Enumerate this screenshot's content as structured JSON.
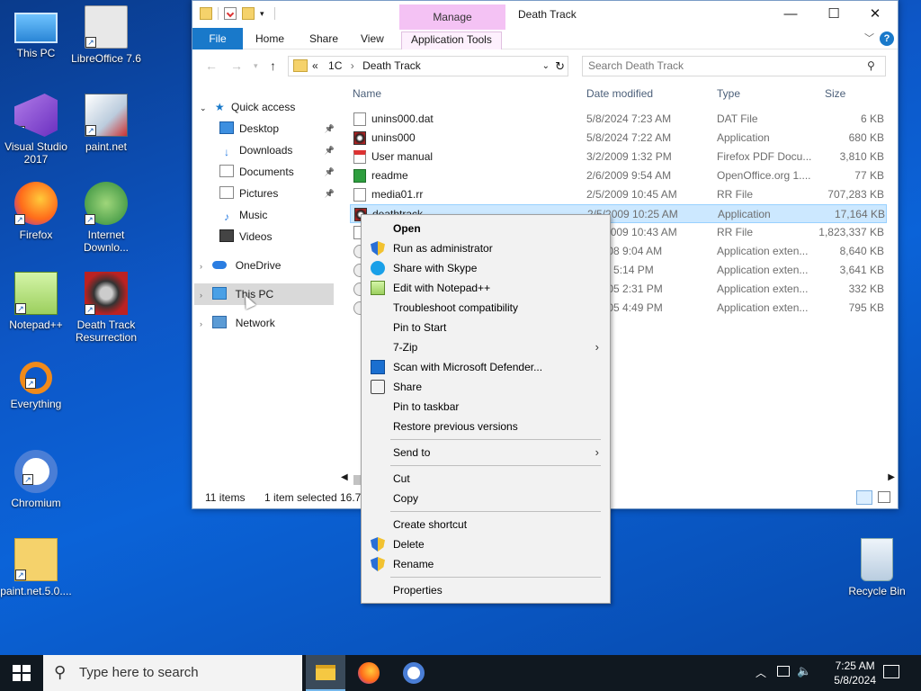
{
  "colors": {
    "accent": "#1979ca",
    "manage_tab": "#f4c2f4",
    "selection": "#cce8ff",
    "taskbar": "#101820",
    "menu_bg": "#f2f2f2"
  },
  "desktop_icons": [
    {
      "label": "This PC",
      "icon": "monitor-icon"
    },
    {
      "label": "LibreOffice 7.6",
      "icon": "document-icon"
    },
    {
      "label": "Visual Studio 2017",
      "icon": "visual-studio-icon"
    },
    {
      "label": "paint.net",
      "icon": "paintnet-icon"
    },
    {
      "label": "Firefox",
      "icon": "firefox-icon"
    },
    {
      "label": "Internet Downlo...",
      "icon": "download-manager-icon"
    },
    {
      "label": "Notepad++",
      "icon": "notepad-icon"
    },
    {
      "label": "Death Track Resurrection",
      "icon": "game-icon"
    },
    {
      "label": "Everything",
      "icon": "search-icon"
    },
    {
      "label": "Chromium",
      "icon": "chromium-icon"
    },
    {
      "label": "paint.net.5.0....",
      "icon": "zip-folder-icon"
    },
    {
      "label": "Recycle Bin",
      "icon": "recycle-bin-icon"
    }
  ],
  "explorer": {
    "title": "Death Track",
    "manage_label": "Manage",
    "ribbon_tabs": [
      "File",
      "Home",
      "Share",
      "View",
      "Application Tools"
    ],
    "address_path": [
      "«",
      "1C",
      "›",
      "Death Track"
    ],
    "search_placeholder": "Search Death Track",
    "columns": [
      "Name",
      "Date modified",
      "Type",
      "Size"
    ],
    "nav": {
      "quick_access": "Quick access",
      "items": [
        "Desktop",
        "Downloads",
        "Documents",
        "Pictures",
        "Music",
        "Videos"
      ],
      "onedrive": "OneDrive",
      "this_pc": "This PC",
      "network": "Network"
    },
    "files": [
      {
        "name": "unins000.dat",
        "date": "5/8/2024 7:23 AM",
        "type": "DAT File",
        "size": "6 KB",
        "icon": "file-icon"
      },
      {
        "name": "unins000",
        "date": "5/8/2024 7:22 AM",
        "type": "Application",
        "size": "680 KB",
        "icon": "app-icon"
      },
      {
        "name": "User manual",
        "date": "3/2/2009 1:32 PM",
        "type": "Firefox PDF Docu...",
        "size": "3,810 KB",
        "icon": "pdf-icon"
      },
      {
        "name": "readme",
        "date": "2/6/2009 9:54 AM",
        "type": "OpenOffice.org 1....",
        "size": "77 KB",
        "icon": "doc-icon"
      },
      {
        "name": "media01.rr",
        "date": "2/5/2009 10:45 AM",
        "type": "RR File",
        "size": "707,283 KB",
        "icon": "file-icon"
      },
      {
        "name": "deathtrack",
        "date": "2/5/2009 10:25 AM",
        "type": "Application",
        "size": "17,164 KB",
        "icon": "app-icon",
        "selected": true
      },
      {
        "name": "",
        "date": "2/5/2009 10:43 AM",
        "type": "RR File",
        "size": "1,823,337 KB",
        "icon": "file-icon"
      },
      {
        "name": "",
        "date": "5/2008 9:04 AM",
        "type": "Application exten...",
        "size": "8,640 KB",
        "icon": "dll-icon"
      },
      {
        "name": "",
        "date": "2007 5:14 PM",
        "type": "Application exten...",
        "size": "3,641 KB",
        "icon": "dll-icon"
      },
      {
        "name": "",
        "date": "3/2005 2:31 PM",
        "type": "Application exten...",
        "size": "332 KB",
        "icon": "dll-icon"
      },
      {
        "name": "",
        "date": "3/2005 4:49 PM",
        "type": "Application exten...",
        "size": "795 KB",
        "icon": "dll-icon"
      }
    ],
    "status": {
      "items": "11 items",
      "selected": "1 item selected",
      "size": "16.7"
    }
  },
  "context_menu": [
    {
      "label": "Open",
      "bold": true
    },
    {
      "label": "Run as administrator",
      "icon": "shield-icon"
    },
    {
      "label": "Share with Skype",
      "icon": "skype-icon"
    },
    {
      "label": "Edit with Notepad++",
      "icon": "notepad-icon"
    },
    {
      "label": "Troubleshoot compatibility"
    },
    {
      "label": "Pin to Start"
    },
    {
      "label": "7-Zip",
      "submenu": true
    },
    {
      "label": "Scan with Microsoft Defender...",
      "icon": "defender-icon"
    },
    {
      "label": "Share",
      "icon": "share-icon"
    },
    {
      "label": "Pin to taskbar"
    },
    {
      "label": "Restore previous versions"
    },
    {
      "sep": true
    },
    {
      "label": "Send to",
      "submenu": true
    },
    {
      "sep": true
    },
    {
      "label": "Cut"
    },
    {
      "label": "Copy"
    },
    {
      "sep": true
    },
    {
      "label": "Create shortcut"
    },
    {
      "label": "Delete",
      "icon": "shield-icon"
    },
    {
      "label": "Rename",
      "icon": "shield-icon"
    },
    {
      "sep": true
    },
    {
      "label": "Properties"
    }
  ],
  "taskbar": {
    "search_placeholder": "Type here to search",
    "time": "7:25 AM",
    "date": "5/8/2024"
  }
}
